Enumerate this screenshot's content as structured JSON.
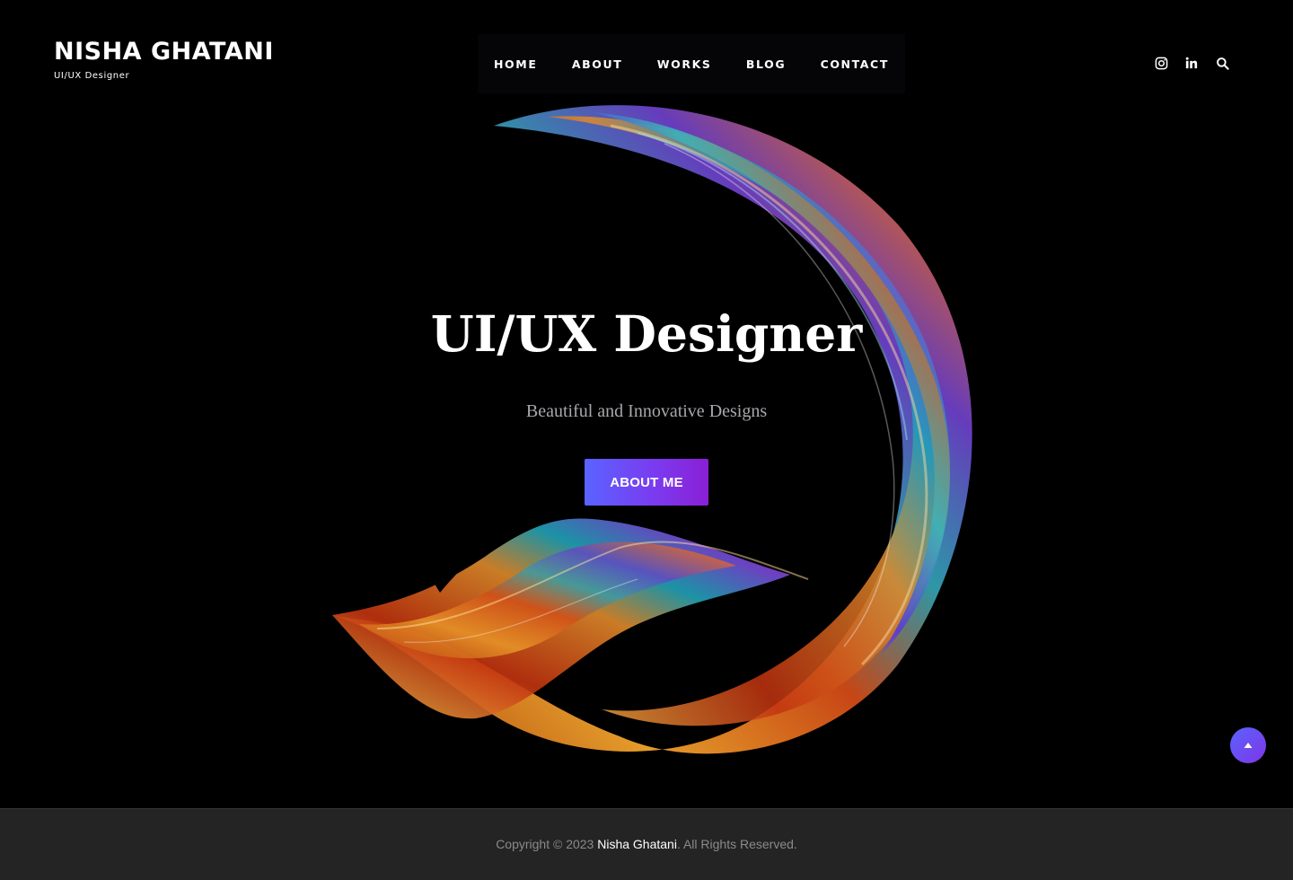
{
  "brand": {
    "name": "NISHA GHATANI",
    "tagline": "UI/UX Designer"
  },
  "nav": {
    "items": [
      {
        "label": "HOME"
      },
      {
        "label": "ABOUT"
      },
      {
        "label": "WORKS"
      },
      {
        "label": "BLOG"
      },
      {
        "label": "CONTACT"
      }
    ]
  },
  "header_icons": [
    "instagram-icon",
    "linkedin-icon",
    "search-icon"
  ],
  "hero": {
    "title": "UI/UX Designer",
    "subtitle": "Beautiful and Innovative Designs",
    "button_label": "ABOUT ME"
  },
  "footer": {
    "copyright_prefix": "Copyright © 2023 ",
    "owner": "Nisha Ghatani",
    "rights": ". All Rights Reserved."
  },
  "colors": {
    "background": "#000000",
    "accent_start": "#5a63ff",
    "accent_end": "#8a1fd6",
    "footer_bg": "#242424"
  }
}
